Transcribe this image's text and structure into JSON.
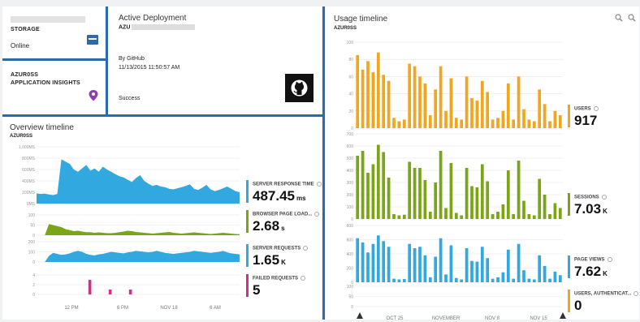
{
  "storage": {
    "name": "",
    "label": "STORAGE",
    "status": "Online"
  },
  "insights": {
    "name": "AZUR0SS",
    "label": "APPLICATION INSIGHTS"
  },
  "deployment": {
    "title": "Active Deployment",
    "name": "AZU",
    "by": "By GitHub",
    "timestamp": "11/13/2015 11:50:57 AM",
    "result": "Success"
  },
  "overview": {
    "title": "Overview timeline",
    "subtitle": "AZUR0SS",
    "time_labels": [
      "12 PM",
      "6 PM",
      "NOV 18",
      "6 AM"
    ],
    "metrics": [
      {
        "name": "SERVER RESPONSE TIME",
        "value": "487.45",
        "unit": "ms",
        "color": "#31a8df"
      },
      {
        "name": "BROWSER PAGE LOAD...",
        "value": "2.68",
        "unit": "s",
        "color": "#79a516"
      },
      {
        "name": "SERVER REQUESTS",
        "value": "1.65",
        "unit": "K",
        "color": "#31a8df"
      },
      {
        "name": "FAILED REQUESTS",
        "value": "5",
        "unit": "",
        "color": "#d62d8a"
      }
    ]
  },
  "usage": {
    "title": "Usage timeline",
    "subtitle": "AZUR0SS",
    "time_labels": [
      "OCT 25",
      "NOVEMBER",
      "NOV 8",
      "NOV 15"
    ],
    "metrics": [
      {
        "name": "USERS",
        "value": "917",
        "unit": "",
        "color": "#f0a61e"
      },
      {
        "name": "SESSIONS",
        "value": "7.03",
        "unit": "K",
        "color": "#79a516"
      },
      {
        "name": "PAGE VIEWS",
        "value": "7.62",
        "unit": "K",
        "color": "#31a8df"
      },
      {
        "name": "USERS, AUTHENTICAT...",
        "value": "0",
        "unit": "",
        "color": "#f0a61e"
      }
    ]
  },
  "chart_data": [
    {
      "type": "area",
      "title": "Overview timeline",
      "ylabel": "",
      "ytick_labels": [
        "1,000MS",
        "800MS",
        "600MS",
        "400MS",
        "200MS",
        "0MS"
      ],
      "ylim": [
        0,
        1000
      ],
      "series": [
        {
          "name": "SERVER RESPONSE TIME",
          "values": [
            180,
            170,
            175,
            160,
            150,
            170,
            780,
            740,
            700,
            600,
            560,
            620,
            680,
            580,
            620,
            560,
            650,
            600,
            560,
            520,
            480,
            460,
            420,
            380,
            450,
            500,
            400,
            350,
            310,
            330,
            300,
            290,
            260,
            250,
            270,
            290,
            310,
            340,
            260,
            240,
            280,
            330,
            250,
            220,
            240,
            270,
            300,
            260,
            220,
            200
          ]
        }
      ]
    },
    {
      "type": "area",
      "ytick_labels": [
        "100",
        "50",
        "0"
      ],
      "ylim": [
        0,
        100
      ],
      "series": [
        {
          "name": "BROWSER PAGE LOAD...",
          "values": [
            0,
            0,
            0,
            55,
            50,
            45,
            40,
            30,
            25,
            20,
            22,
            18,
            15,
            15,
            12,
            14,
            12,
            10,
            10,
            12,
            15,
            18,
            22,
            20,
            16,
            14,
            12,
            10,
            8,
            10,
            12,
            14,
            16,
            12,
            10,
            8,
            10,
            12,
            14,
            12,
            10,
            8,
            6,
            8,
            10,
            12,
            10,
            8,
            6,
            5
          ]
        }
      ]
    },
    {
      "type": "area",
      "ytick_labels": [
        "200",
        "100",
        "0"
      ],
      "ylim": [
        0,
        200
      ],
      "series": [
        {
          "name": "SERVER REQUESTS",
          "values": [
            0,
            0,
            0,
            60,
            90,
            80,
            70,
            75,
            85,
            100,
            110,
            100,
            80,
            70,
            65,
            75,
            80,
            90,
            100,
            95,
            90,
            85,
            95,
            100,
            110,
            105,
            100,
            95,
            100,
            110,
            100,
            90,
            85,
            80,
            85,
            90,
            95,
            100,
            110,
            105,
            100,
            95,
            90,
            95,
            100,
            110,
            95,
            85,
            80,
            75
          ]
        }
      ]
    },
    {
      "type": "bar",
      "ytick_labels": [
        "4",
        "2",
        "0"
      ],
      "ylim": [
        0,
        4
      ],
      "series": [
        {
          "name": "FAILED REQUESTS",
          "values": [
            0,
            0,
            0,
            0,
            0,
            0,
            0,
            0,
            0,
            0,
            3,
            0,
            0,
            0,
            1,
            0,
            0,
            0,
            1,
            0,
            0,
            0,
            0,
            0,
            0,
            0,
            0,
            0,
            0,
            0,
            0,
            0,
            0,
            0,
            0,
            0,
            0,
            0,
            0,
            0
          ]
        }
      ]
    },
    {
      "type": "bar",
      "title": "Usage timeline",
      "ytick_labels": [
        "100",
        "80",
        "60",
        "40",
        "20",
        "0"
      ],
      "ylim": [
        0,
        100
      ],
      "series": [
        {
          "name": "USERS",
          "values": [
            85,
            68,
            78,
            65,
            88,
            62,
            55,
            12,
            8,
            10,
            75,
            72,
            60,
            52,
            15,
            45,
            72,
            20,
            58,
            12,
            10,
            60,
            35,
            32,
            55,
            42,
            10,
            12,
            20,
            52,
            10,
            60,
            22,
            10,
            8,
            45,
            28,
            8,
            20,
            15
          ]
        }
      ]
    },
    {
      "type": "bar",
      "ytick_labels": [
        "700",
        "600",
        "500",
        "400",
        "300",
        "200",
        "100",
        "0"
      ],
      "ylim": [
        0,
        700
      ],
      "series": [
        {
          "name": "SESSIONS",
          "values": [
            520,
            560,
            380,
            450,
            610,
            550,
            340,
            40,
            30,
            35,
            470,
            420,
            420,
            320,
            60,
            300,
            560,
            90,
            460,
            50,
            30,
            420,
            270,
            260,
            450,
            310,
            40,
            60,
            120,
            400,
            40,
            480,
            150,
            40,
            30,
            330,
            200,
            40,
            130,
            90
          ]
        }
      ]
    },
    {
      "type": "bar",
      "ytick_labels": [
        "800",
        "600",
        "400",
        "200",
        "0"
      ],
      "ylim": [
        0,
        800
      ],
      "series": [
        {
          "name": "PAGE VIEWS",
          "values": [
            620,
            560,
            420,
            540,
            660,
            580,
            500,
            50,
            40,
            45,
            540,
            480,
            500,
            380,
            70,
            360,
            620,
            110,
            520,
            60,
            40,
            480,
            300,
            290,
            500,
            340,
            50,
            70,
            140,
            460,
            50,
            540,
            170,
            50,
            40,
            380,
            230,
            50,
            150,
            100
          ]
        }
      ]
    },
    {
      "type": "bar",
      "ytick_labels": [
        "100",
        "50",
        "0"
      ],
      "ylim": [
        0,
        100
      ],
      "series": [
        {
          "name": "USERS, AUTHENTICAT...",
          "values": []
        }
      ]
    }
  ]
}
